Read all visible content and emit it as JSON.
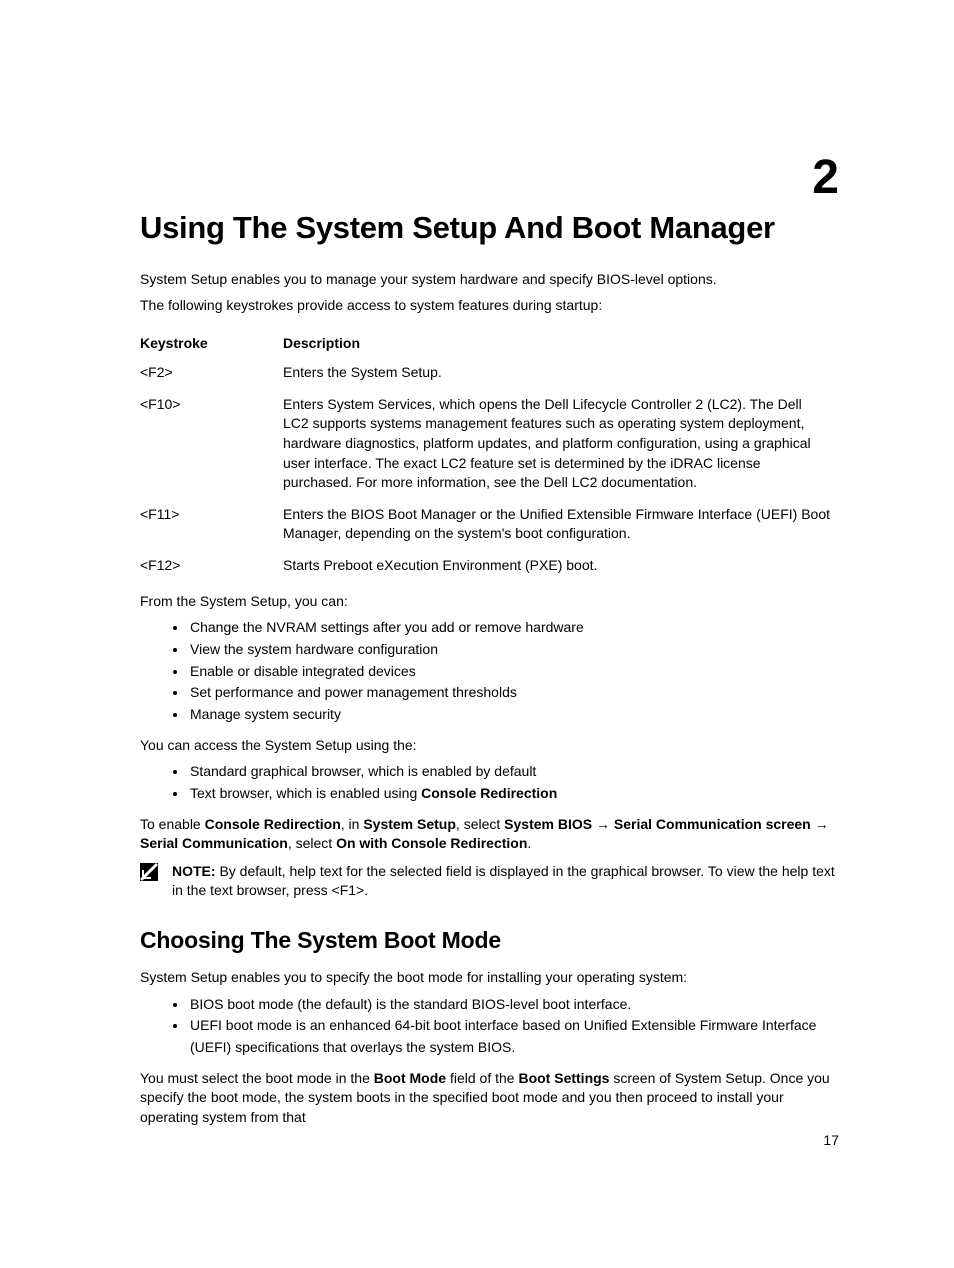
{
  "chapter_number": "2",
  "title": "Using The System Setup And Boot Manager",
  "intro_p1": "System Setup enables you to manage your system hardware and specify BIOS-level options.",
  "intro_p2": "The following keystrokes provide access to system features during startup:",
  "table": {
    "head_keystroke": "Keystroke",
    "head_description": "Description",
    "rows": [
      {
        "key": "<F2>",
        "desc": "Enters the System Setup."
      },
      {
        "key": "<F10>",
        "desc": "Enters System Services, which opens the Dell Lifecycle Controller 2 (LC2). The Dell LC2 supports systems management features such as operating system deployment, hardware diagnostics, platform updates, and platform configuration, using a graphical user interface. The exact LC2 feature set is determined by the iDRAC license purchased. For more information, see the Dell LC2 documentation."
      },
      {
        "key": "<F11>",
        "desc": "Enters the BIOS Boot Manager or the Unified Extensible Firmware Interface (UEFI) Boot Manager, depending on the system's boot configuration."
      },
      {
        "key": "<F12>",
        "desc": "Starts Preboot eXecution Environment (PXE) boot."
      }
    ]
  },
  "after_table_p": "From the System Setup, you can:",
  "bullets1": [
    "Change the NVRAM settings after you add or remove hardware",
    "View the system hardware configuration",
    "Enable or disable integrated devices",
    "Set performance and power management thresholds",
    "Manage system security"
  ],
  "access_p": "You can access the System Setup using the:",
  "bullets2_item1": "Standard graphical browser, which is enabled by default",
  "bullets2_item2_pre": "Text browser, which is enabled using ",
  "bullets2_item2_bold": "Console Redirection",
  "enable_p": {
    "t1": "To enable ",
    "b1": "Console Redirection",
    "t2": ", in ",
    "b2": "System Setup",
    "t3": ", select ",
    "b3": "System BIOS",
    "arrow1": " → ",
    "b4": "Serial Communication screen",
    "arrow2": " → ",
    "b5": "Serial Communication",
    "t4": ", select ",
    "b6": "On with Console Redirection",
    "t5": "."
  },
  "note": {
    "label": "NOTE:",
    "text": " By default, help text for the selected field is displayed in the graphical browser. To view the help text in the text browser, press <F1>."
  },
  "subhead": "Choosing The System Boot Mode",
  "sub_p1": "System Setup enables you to specify the boot mode for installing your operating system:",
  "bullets3": [
    "BIOS boot mode (the default) is the standard BIOS-level boot interface.",
    "UEFI boot mode is an enhanced 64-bit boot interface based on Unified Extensible Firmware Interface (UEFI) specifications that overlays the system BIOS."
  ],
  "final_p": {
    "t1": "You must select the boot mode in the ",
    "b1": "Boot Mode",
    "t2": " field of the ",
    "b2": "Boot Settings",
    "t3": " screen of System Setup. Once you specify the boot mode, the system boots in the specified boot mode and you then proceed to install your operating system from that"
  },
  "page_number": "17"
}
